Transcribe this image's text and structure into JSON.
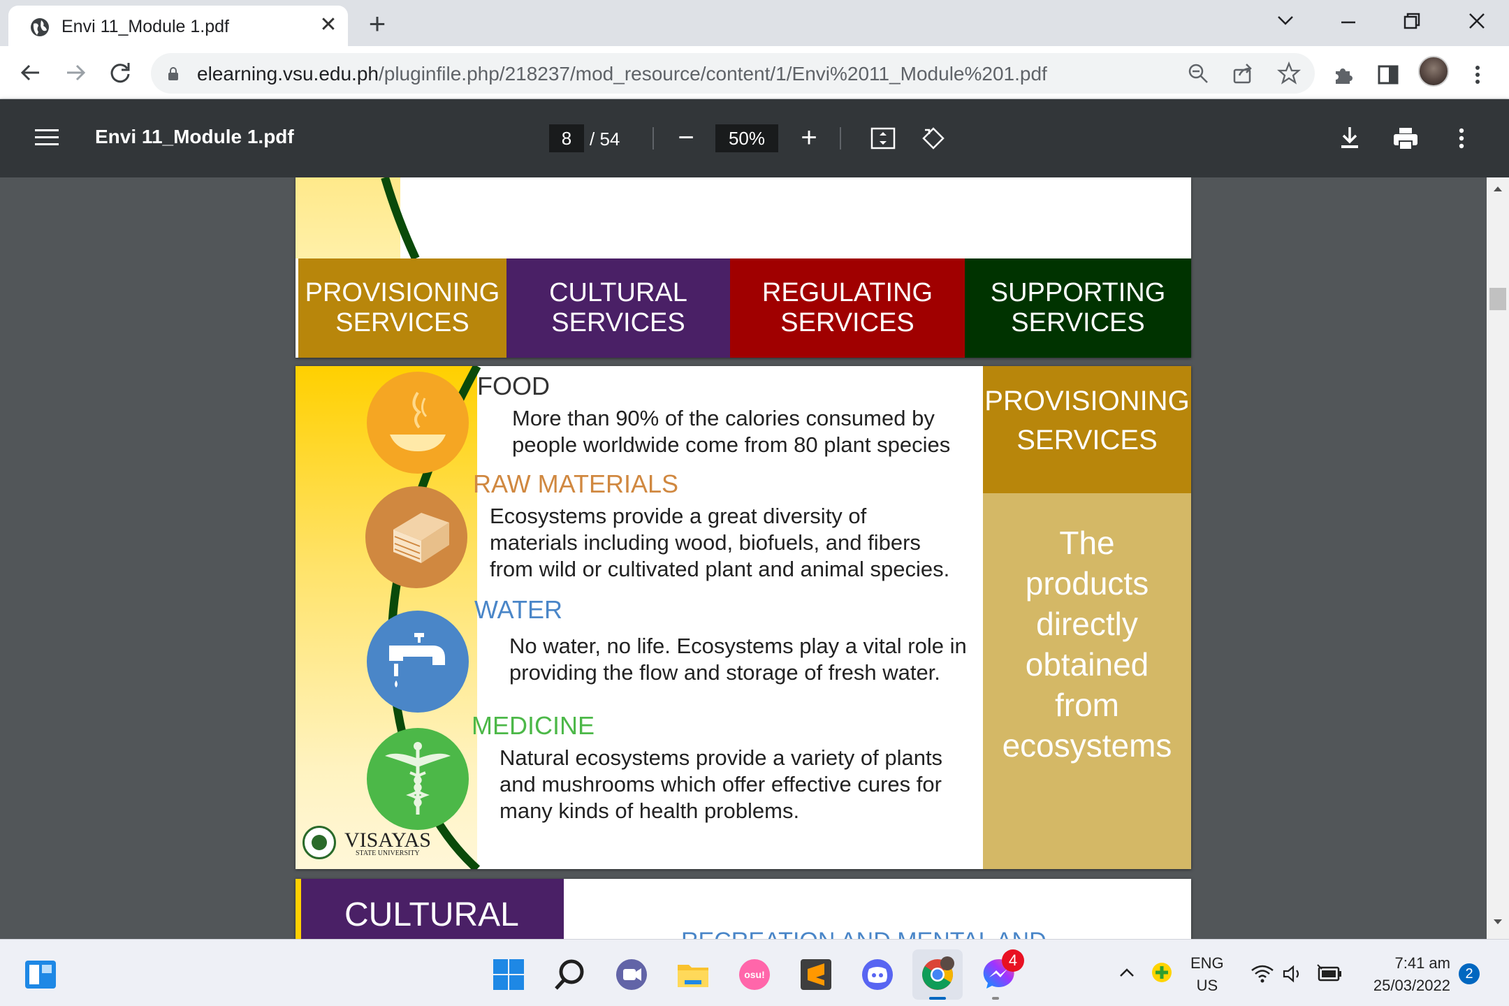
{
  "browser": {
    "tab_title": "Envi 11_Module 1.pdf",
    "url_host": "elearning.vsu.edu.ph",
    "url_path": "/pluginfile.php/218237/mod_resource/content/1/Envi%2011_Module%201.pdf"
  },
  "pdf_toolbar": {
    "file_name": "Envi 11_Module 1.pdf",
    "current_page": "8",
    "total_pages": "/ 54",
    "zoom": "50%"
  },
  "page1": {
    "services": [
      {
        "line1": "PROVISIONING",
        "line2": "SERVICES",
        "color": "#b8860b"
      },
      {
        "line1": "CULTURAL",
        "line2": "SERVICES",
        "color": "#4a2066"
      },
      {
        "line1": "REGULATING",
        "line2": "SERVICES",
        "color": "#a00000"
      },
      {
        "line1": "SUPPORTING",
        "line2": "SERVICES",
        "color": "#003300"
      }
    ]
  },
  "page2": {
    "sections": [
      {
        "heading": "FOOD",
        "color": "#333333",
        "body1": "More than 90% of the calories consumed by",
        "body2": "people worldwide come from 80 plant species",
        "body3": ""
      },
      {
        "heading": "RAW MATERIALS",
        "color": "#d08840",
        "body1": "Ecosystems provide a great diversity of",
        "body2": "materials including wood, biofuels, and fibers",
        "body3": "from wild or cultivated plant and animal species."
      },
      {
        "heading": "WATER",
        "color": "#4a86c8",
        "body1": "No water, no life. Ecosystems play a vital role in",
        "body2": "providing the flow and storage of fresh water.",
        "body3": ""
      },
      {
        "heading": "MEDICINE",
        "color": "#4cb848",
        "body1": "Natural ecosystems provide a variety of plants",
        "body2": "and mushrooms which offer effective cures for",
        "body3": "many kinds of health problems."
      }
    ],
    "side_title_1": "PROVISIONING",
    "side_title_2": "SERVICES",
    "side_desc": [
      "The",
      "products",
      "directly",
      "obtained",
      "from",
      "ecosystems"
    ],
    "logo_text": "VISAYAS",
    "logo_sub": "STATE UNIVERSITY"
  },
  "page3": {
    "title": "CULTURAL",
    "subtitle_partial": "RECREATION AND MENTAL AND"
  },
  "taskbar": {
    "lang1": "ENG",
    "lang2": "US",
    "time": "7:41 am",
    "date": "25/03/2022",
    "notifications": "2",
    "messenger_badge": "4"
  }
}
